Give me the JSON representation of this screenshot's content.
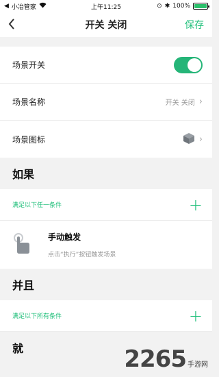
{
  "status_bar": {
    "carrier": "小冶管家",
    "time": "上午11:25",
    "battery": "100%"
  },
  "nav": {
    "title": "开关 关闭",
    "save": "保存"
  },
  "settings": {
    "switch_label": "场景开关",
    "switch_on": true,
    "name_label": "场景名称",
    "name_value": "开关 关闭",
    "icon_label": "场景图标"
  },
  "if_section": {
    "title": "如果",
    "condition": "满足以下任一条件",
    "trigger_title": "手动触发",
    "trigger_sub": "点击“执行”按钮触发场景"
  },
  "and_section": {
    "title": "并且",
    "condition": "满足以下所有条件"
  },
  "then_section": {
    "title": "就"
  },
  "watermark": {
    "digits": "2265",
    "site": "手游网"
  },
  "colors": {
    "accent": "#1fbf7a",
    "toggle": "#25b578"
  }
}
